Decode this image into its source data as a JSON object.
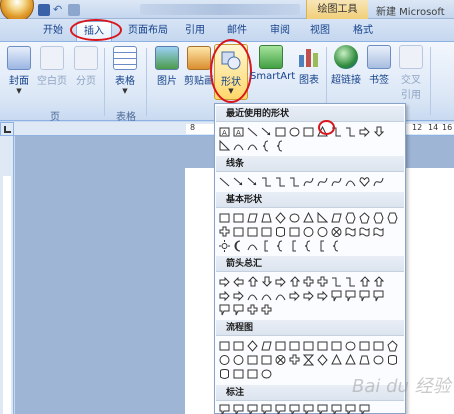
{
  "title_bar": {
    "tools_tab": "绘图工具",
    "document_title": "新建 Microsoft"
  },
  "tabs": [
    {
      "label": "开始"
    },
    {
      "label": "插入"
    },
    {
      "label": "页面布局"
    },
    {
      "label": "引用"
    },
    {
      "label": "邮件"
    },
    {
      "label": "审阅"
    },
    {
      "label": "视图"
    },
    {
      "label": "格式"
    }
  ],
  "ribbon": {
    "cover": "封面",
    "blank_page": "空白页",
    "page_break": "分页",
    "table": "表格",
    "picture": "图片",
    "clipart": "剪贴画",
    "shapes": "形状",
    "smartart": "SmartArt",
    "chart": "图表",
    "hyperlink": "超链接",
    "bookmark": "书签",
    "cross_ref_line1": "交叉",
    "cross_ref_line2": "引用",
    "group_pages": "页",
    "group_table": "表格"
  },
  "ruler": {
    "n8": "8",
    "n12": "12",
    "n14": "14",
    "n16": "16"
  },
  "shapes_gallery": {
    "recent": "最近使用的形状",
    "lines": "线条",
    "basic": "基本形状",
    "arrows": "箭头总汇",
    "flowchart": "流程图",
    "callouts": "标注"
  },
  "watermark": "Bai du 经验",
  "colors": {
    "accent_red": "#d8161b",
    "ribbon_blue": "#15428b"
  }
}
